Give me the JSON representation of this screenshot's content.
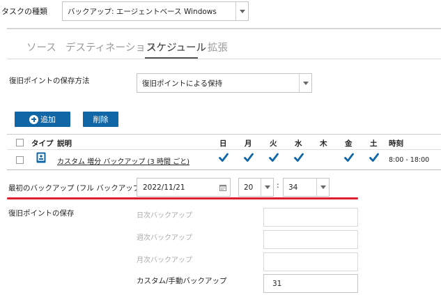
{
  "task_type": {
    "label": "タスクの種類",
    "value": "バックアップ: エージェントベース Windows"
  },
  "tabs": [
    {
      "label": "ソース",
      "active": false
    },
    {
      "label": "デスティネーション",
      "active": false
    },
    {
      "label": "スケジュール",
      "active": true
    },
    {
      "label": "拡張",
      "active": false
    }
  ],
  "retention_method": {
    "label": "復旧ポイントの保存方法",
    "value": "復旧ポイントによる保持"
  },
  "buttons": {
    "add": "追加",
    "delete": "削除"
  },
  "table": {
    "headers": {
      "type": "タイプ",
      "description": "説明",
      "sun": "日",
      "mon": "月",
      "tue": "火",
      "wed": "水",
      "thu": "木",
      "fri": "金",
      "sat": "土",
      "time": "時刻"
    },
    "rows": [
      {
        "description": "カスタム 増分 バックアップ (3 時間 ごと)",
        "days": {
          "sun": true,
          "mon": true,
          "tue": true,
          "wed": true,
          "thu": false,
          "fri": true,
          "sat": true
        },
        "time": "8:00 - 18:00"
      }
    ]
  },
  "first_backup": {
    "label": "最初のバックアップ (フル バックアップ)",
    "date": "2022/11/21",
    "hour": "20",
    "separator": ":",
    "minute": "34"
  },
  "retention": {
    "label": "復旧ポイントの保存",
    "daily_label": "日次バックアップ",
    "daily_value": "",
    "weekly_label": "週次バックアップ",
    "weekly_value": "",
    "monthly_label": "月次バックアップ",
    "monthly_value": "",
    "custom_label": "カスタム/手動バックアップ",
    "custom_value": "31"
  },
  "colors": {
    "accent": "#1166a6",
    "highlight": "#e21b2d"
  }
}
